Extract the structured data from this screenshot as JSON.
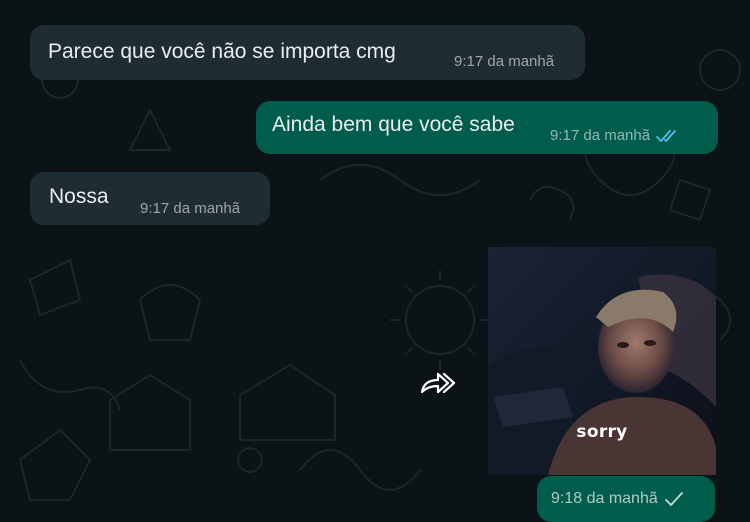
{
  "messages": [
    {
      "direction": "incoming",
      "text": "Parece que você não se importa cmg",
      "time": "9:17 da manhã"
    },
    {
      "direction": "outgoing",
      "text": "Ainda bem que você sabe",
      "time": "9:17 da manhã",
      "status": "read"
    },
    {
      "direction": "incoming",
      "text": "Nossa",
      "time": "9:17 da manhã"
    },
    {
      "direction": "outgoing",
      "type": "image",
      "caption_in_image": "sorry",
      "time": "9:18 da manhã",
      "status": "sent"
    }
  ],
  "icons": {
    "forward": "forward-icon",
    "read_ticks": "double-check-icon",
    "sent_tick": "single-check-icon"
  },
  "colors": {
    "background": "#0c1317",
    "incoming_bubble": "#202c33",
    "outgoing_bubble": "#005c4b",
    "read_tick": "#53bdeb"
  }
}
